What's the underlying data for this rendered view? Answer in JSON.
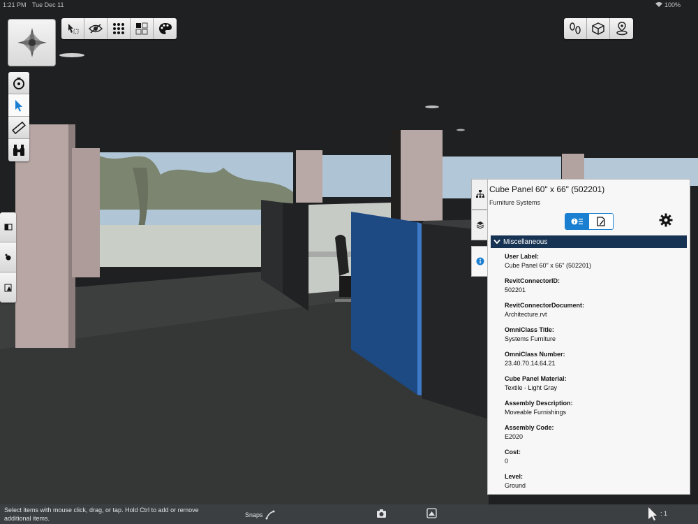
{
  "status_bar": {
    "time": "1:21 PM",
    "date": "Tue Dec 11",
    "battery": "100%"
  },
  "colors": {
    "accent": "#1a7fd1",
    "section_header": "#173353",
    "panel_bg": "#f7f7f7",
    "bottom_bar": "#3c3f42",
    "selected_panel": "#1d4a82"
  },
  "toolbar_top": {
    "icons": [
      "selection-filter-icon",
      "hide-eye-icon",
      "grid-dots-icon",
      "tiles-icon",
      "palette-icon"
    ]
  },
  "toolbar_right": {
    "icons": [
      "footsteps-icon",
      "cube-icon",
      "location-pin-icon"
    ]
  },
  "tool_column": {
    "icons": [
      "orbit-icon",
      "select-arrow-icon",
      "measure-ruler-icon",
      "binoculars-icon"
    ]
  },
  "side_left": {
    "icons": [
      "section-box-icon",
      "markup-icon",
      "sheet-icon"
    ]
  },
  "panel_tabs": {
    "icons": [
      "hierarchy-icon",
      "layers-icon",
      "info-icon"
    ]
  },
  "properties": {
    "title": "Cube Panel 60\" x 66\" (502201)",
    "subtitle": "Furniture Systems",
    "view_toggle": [
      "info-list-icon",
      "document-icon"
    ],
    "section": "Miscellaneous",
    "items": [
      {
        "key": "User Label:",
        "value": "Cube Panel 60\" x 66\" (502201)"
      },
      {
        "key": "RevitConnectorID:",
        "value": "502201"
      },
      {
        "key": "RevitConnectorDocument:",
        "value": "Architecture.rvt"
      },
      {
        "key": "OmniClass Title:",
        "value": "Systems Furniture"
      },
      {
        "key": "OmniClass Number:",
        "value": "23.40.70.14.64.21"
      },
      {
        "key": "Cube Panel Material:",
        "value": "Textile - Light Gray"
      },
      {
        "key": "Assembly Description:",
        "value": "Moveable Furnishings"
      },
      {
        "key": "Assembly Code:",
        "value": "E2020"
      },
      {
        "key": "Cost:",
        "value": "0"
      },
      {
        "key": "Level:",
        "value": "Ground"
      }
    ]
  },
  "bottom_bar": {
    "hint": "Select items with mouse click, drag, or tap. Hold Ctrl to add or remove additional items.",
    "snaps_label": "Snaps",
    "selection_count": ": 1"
  }
}
